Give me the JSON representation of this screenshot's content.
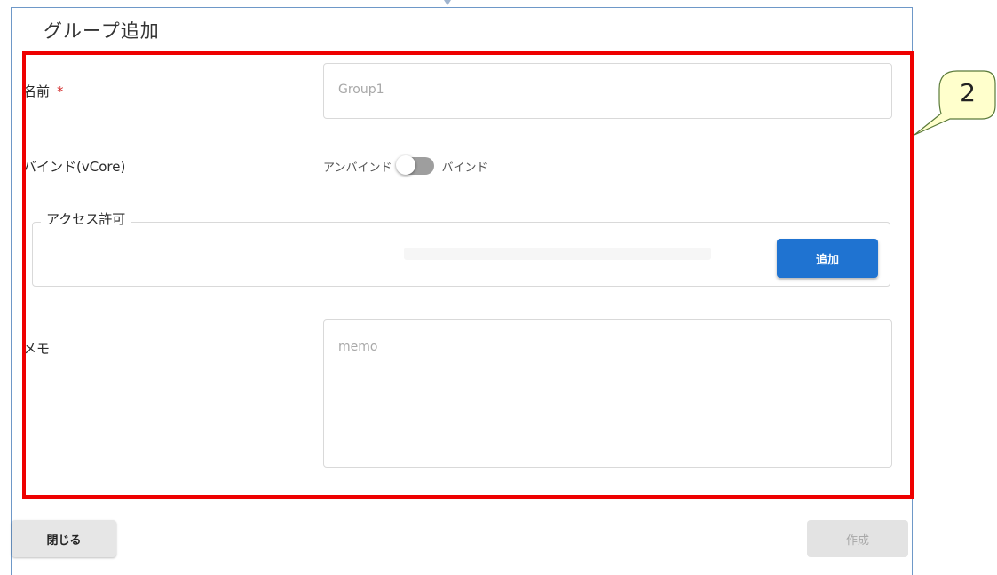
{
  "dialog": {
    "title": "グループ追加"
  },
  "form": {
    "name": {
      "label": "名前",
      "required_mark": "*",
      "placeholder": "Group1"
    },
    "bind": {
      "label": "バインド(vCore)",
      "off_label": "アンバインド",
      "on_label": "バインド",
      "state": "off"
    },
    "access": {
      "legend": "アクセス許可",
      "add_label": "追加"
    },
    "memo": {
      "label": "メモ",
      "placeholder": "memo"
    }
  },
  "footer": {
    "close_label": "閉じる",
    "create_label": "作成"
  },
  "annotation": {
    "callout_number": "2",
    "highlight_color": "#ee0000",
    "callout_fill": "#ffffcc"
  },
  "colors": {
    "primary_button": "#1f73d1",
    "dialog_border": "#6e98c8"
  }
}
